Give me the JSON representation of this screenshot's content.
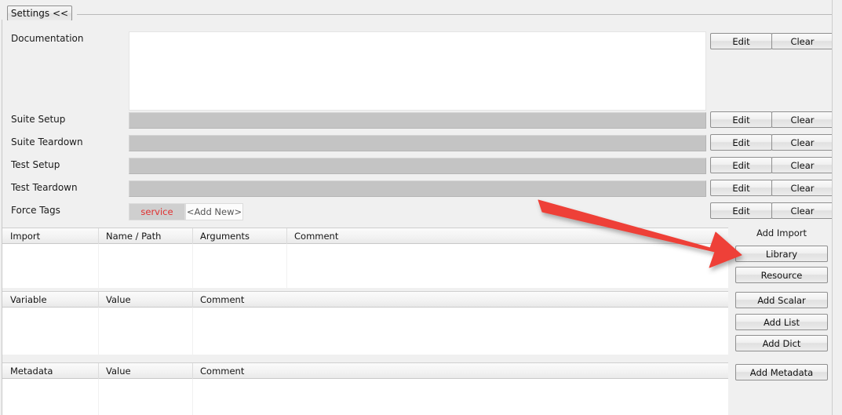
{
  "window": {
    "tab_label": "Settings <<"
  },
  "form": {
    "rows": [
      {
        "label": "Documentation",
        "type": "textarea",
        "value": ""
      },
      {
        "label": "Suite Setup",
        "type": "field",
        "value": ""
      },
      {
        "label": "Suite Teardown",
        "type": "field",
        "value": ""
      },
      {
        "label": "Test Setup",
        "type": "field",
        "value": ""
      },
      {
        "label": "Test Teardown",
        "type": "field",
        "value": ""
      },
      {
        "label": "Force Tags",
        "type": "tags",
        "value": ""
      }
    ],
    "edit_label": "Edit",
    "clear_label": "Clear",
    "tags": [
      "service"
    ],
    "add_new_placeholder": "<Add New>"
  },
  "import_grid": {
    "headers": [
      "Import",
      "Name / Path",
      "Arguments",
      "Comment"
    ],
    "rows": []
  },
  "variable_grid": {
    "headers": [
      "Variable",
      "Value",
      "Comment"
    ],
    "rows": []
  },
  "metadata_grid": {
    "headers": [
      "Metadata",
      "Value",
      "Comment"
    ],
    "rows": []
  },
  "actions": {
    "add_import_label": "Add Import",
    "library_label": "Library",
    "resource_label": "Resource",
    "add_scalar_label": "Add Scalar",
    "add_list_label": "Add List",
    "add_dict_label": "Add Dict",
    "add_metadata_label": "Add Metadata"
  },
  "annotation": {
    "arrow_color": "#ee4037",
    "arrow_target": "library-button"
  },
  "colors": {
    "panel_bg": "#f0f0f0",
    "field_gray": "#c4c4c4",
    "tag_text": "#e03030",
    "grid_bg": "#ffffff"
  }
}
